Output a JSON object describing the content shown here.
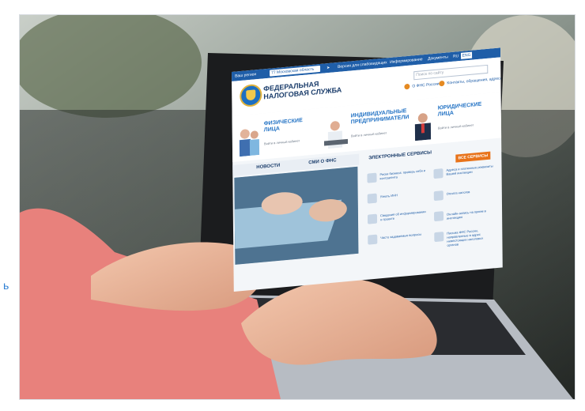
{
  "edge_glyph": "ь",
  "site": {
    "topbar": {
      "left_link": "Ваш регион",
      "region": "77 Московская область",
      "vision": "Версия для слабовидящих",
      "info": "Информирование",
      "docs": "Документы",
      "lang_label": "RU",
      "lang_value": "ENG"
    },
    "title_line1": "ФЕДЕРАЛЬНАЯ",
    "title_line2": "НАЛОГОВАЯ СЛУЖБА",
    "search_placeholder": "Поиск по сайту",
    "link_about": "О ФНС России",
    "link_contacts": "Контакты, обращения, адреса",
    "segments": [
      {
        "label": "ФИЗИЧЕСКИЕ ЛИЦА",
        "sub": "Войти в личный кабинет"
      },
      {
        "label": "ИНДИВИДУАЛЬНЫЕ ПРЕДПРИНИМАТЕЛИ",
        "sub": "Войти в личный кабинет"
      },
      {
        "label": "ЮРИДИЧЕСКИЕ ЛИЦА",
        "sub": "Войти в личный кабинет"
      }
    ],
    "tabs": {
      "news": "НОВОСТИ",
      "smi": "СМИ О ФНС"
    },
    "services_title": "ЭЛЕКТРОННЫЕ СЕРВИСЫ",
    "all_services": "ВСЕ СЕРВИСЫ",
    "services": [
      "Риски бизнеса: проверь себя и контрагента",
      "Адреса и платежные реквизиты Вашей инспекции",
      "Узнать ИНН",
      "Оплата налогов",
      "Сведения об информировании о проекте",
      "Онлайн-запись на прием в инспекцию",
      "Часто задаваемые вопросы",
      "Письма ФНС России, направленные в адрес нижестоящих налоговых органов"
    ],
    "pager": "• • •"
  },
  "colors": {
    "brand_blue": "#1f5ea8",
    "accent_orange": "#e8731a",
    "sweater": "#e8817c"
  }
}
